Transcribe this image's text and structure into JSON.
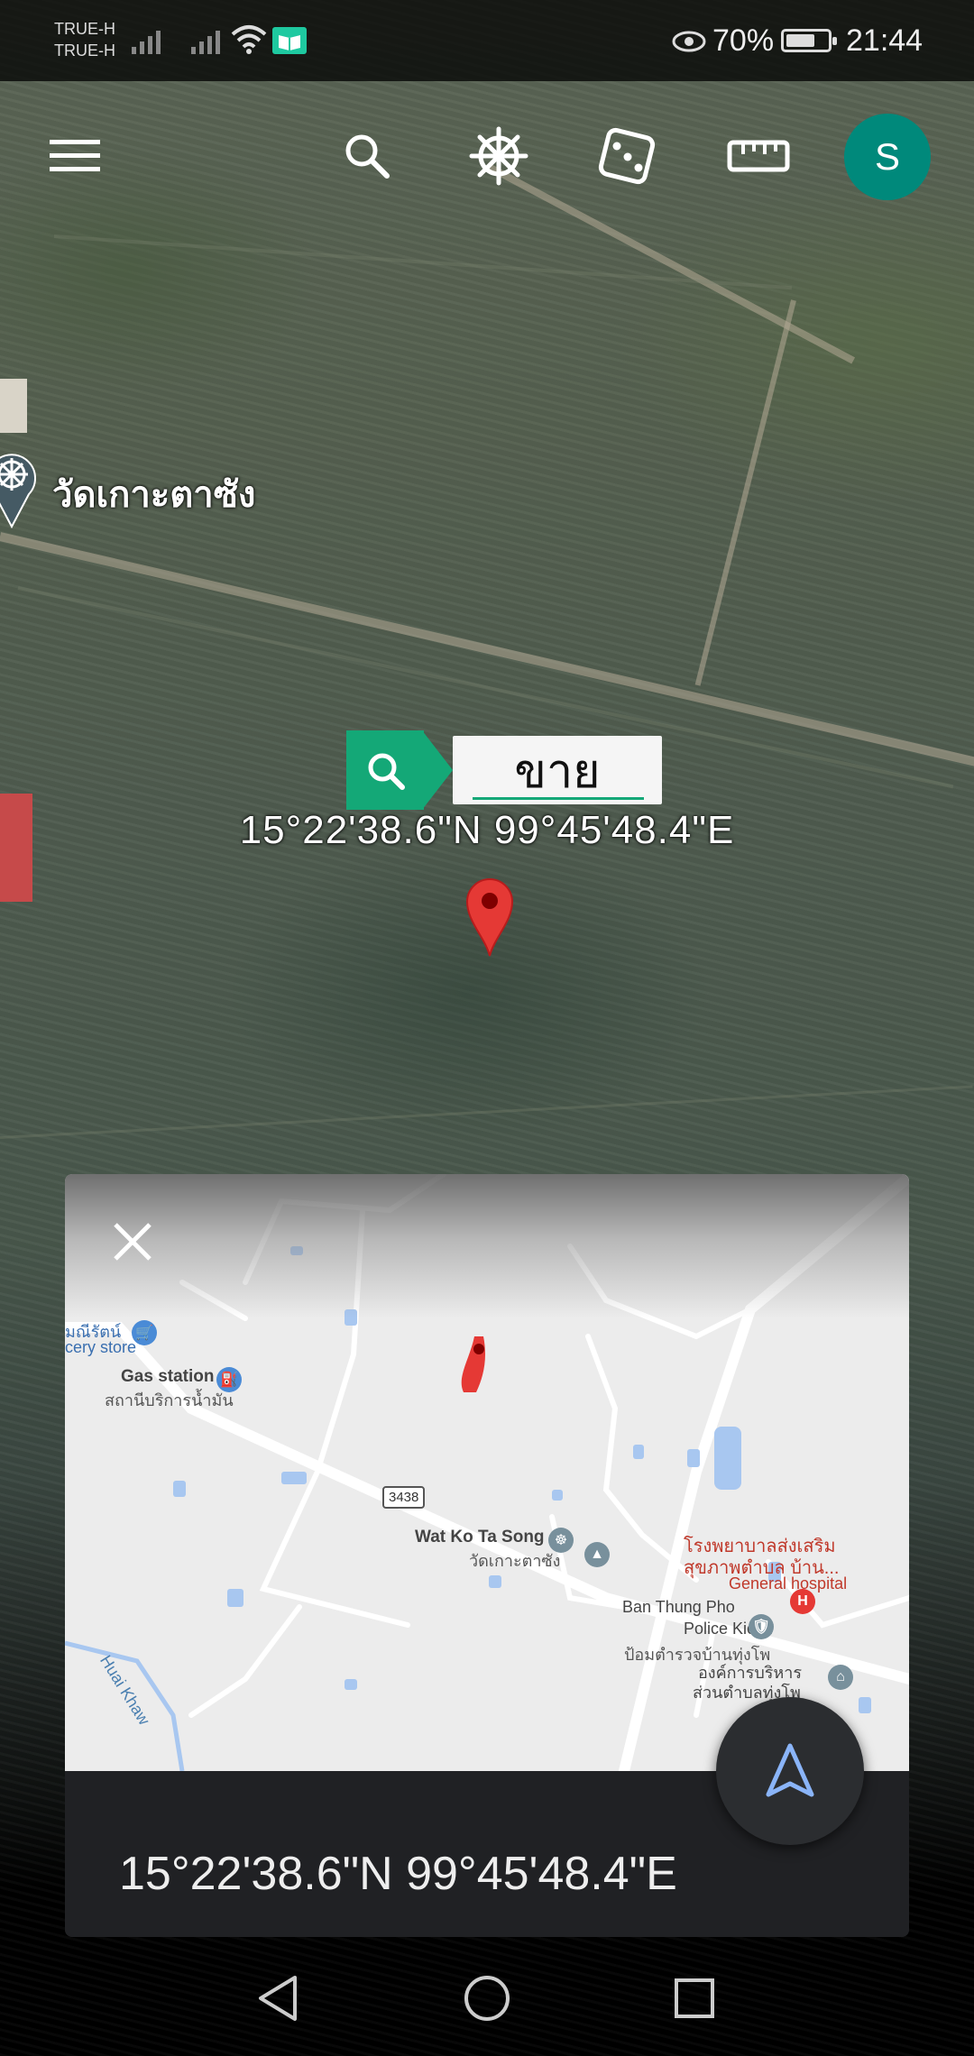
{
  "status_bar": {
    "carrier_1": "TRUE-H",
    "carrier_2": "TRUE-H",
    "battery": "70%",
    "battery_level": 0.7,
    "time": "21:44"
  },
  "toolbar": {
    "icons": [
      "menu-icon",
      "search-icon",
      "voyager-wheel-icon",
      "dice-icon",
      "ruler-icon"
    ],
    "avatar_initial": "S",
    "avatar_color": "#00897b"
  },
  "map_overlay": {
    "place_label": "วัดเกาะตาซัง",
    "search_chip_text": "ขาย",
    "coordinates": "15°22'38.6\"N 99°45'48.4\"E",
    "pin_color": "#e53935"
  },
  "card": {
    "coordinates": "15°22'38.6\"N 99°45'48.4\"E",
    "map_labels": {
      "store_name": "มณีรัตน์",
      "store_type": "cery store",
      "gas_station_en": "Gas station",
      "gas_station_th": "สถานีบริการน้ำมัน",
      "route_number": "3438",
      "temple_en": "Wat Ko Ta Song",
      "temple_th": "วัดเกาะตาซัง",
      "hospital_th_1": "โรงพยาบาลส่งเสริม",
      "hospital_th_2": "สุขภาพตำบล บ้าน...",
      "hospital_en": "General hospital",
      "police_en_1": "Ban Thung Pho",
      "police_en_2": "Police Kiosk",
      "police_th": "ป้อมตำรวจบ้านทุ่งโพ",
      "admin_th_1": "องค์การบริหาร",
      "admin_th_2": "ส่วนตำบลทุ่งโพ",
      "canal": "Huai Khaw"
    }
  },
  "nav_bar": {
    "buttons": [
      "back-icon",
      "home-icon",
      "recents-icon"
    ]
  },
  "colors": {
    "accent_green": "#14a877",
    "avatar": "#00897b",
    "pin": "#e53935",
    "fab_arrow": "#8ab4f8"
  }
}
